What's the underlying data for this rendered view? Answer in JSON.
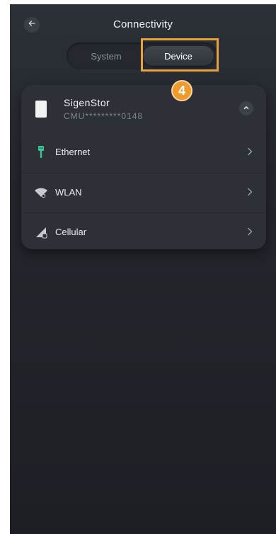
{
  "header": {
    "title": "Connectivity",
    "back_icon": "arrow-left-icon"
  },
  "tabs": [
    {
      "label": "System",
      "selected": false
    },
    {
      "label": "Device",
      "selected": true
    }
  ],
  "annotation": {
    "step_number": "4",
    "highlight_color": "#e9a23b",
    "badge_color": "#ee9a2c"
  },
  "device": {
    "name": "SigenStor",
    "serial": "CMU*********0148",
    "icon": "battery-cabinet-icon",
    "collapse_icon": "chevron-up-icon"
  },
  "connections": [
    {
      "label": "Ethernet",
      "icon": "ethernet-icon",
      "icon_color": "#39c79a"
    },
    {
      "label": "WLAN",
      "icon": "wlan-icon",
      "icon_color": "#c8ccd2"
    },
    {
      "label": "Cellular",
      "icon": "cellular-icon",
      "icon_color": "#c8ccd2"
    }
  ],
  "colors": {
    "background": "#23272d",
    "card": "#2d3137",
    "accent_green": "#39c79a"
  }
}
